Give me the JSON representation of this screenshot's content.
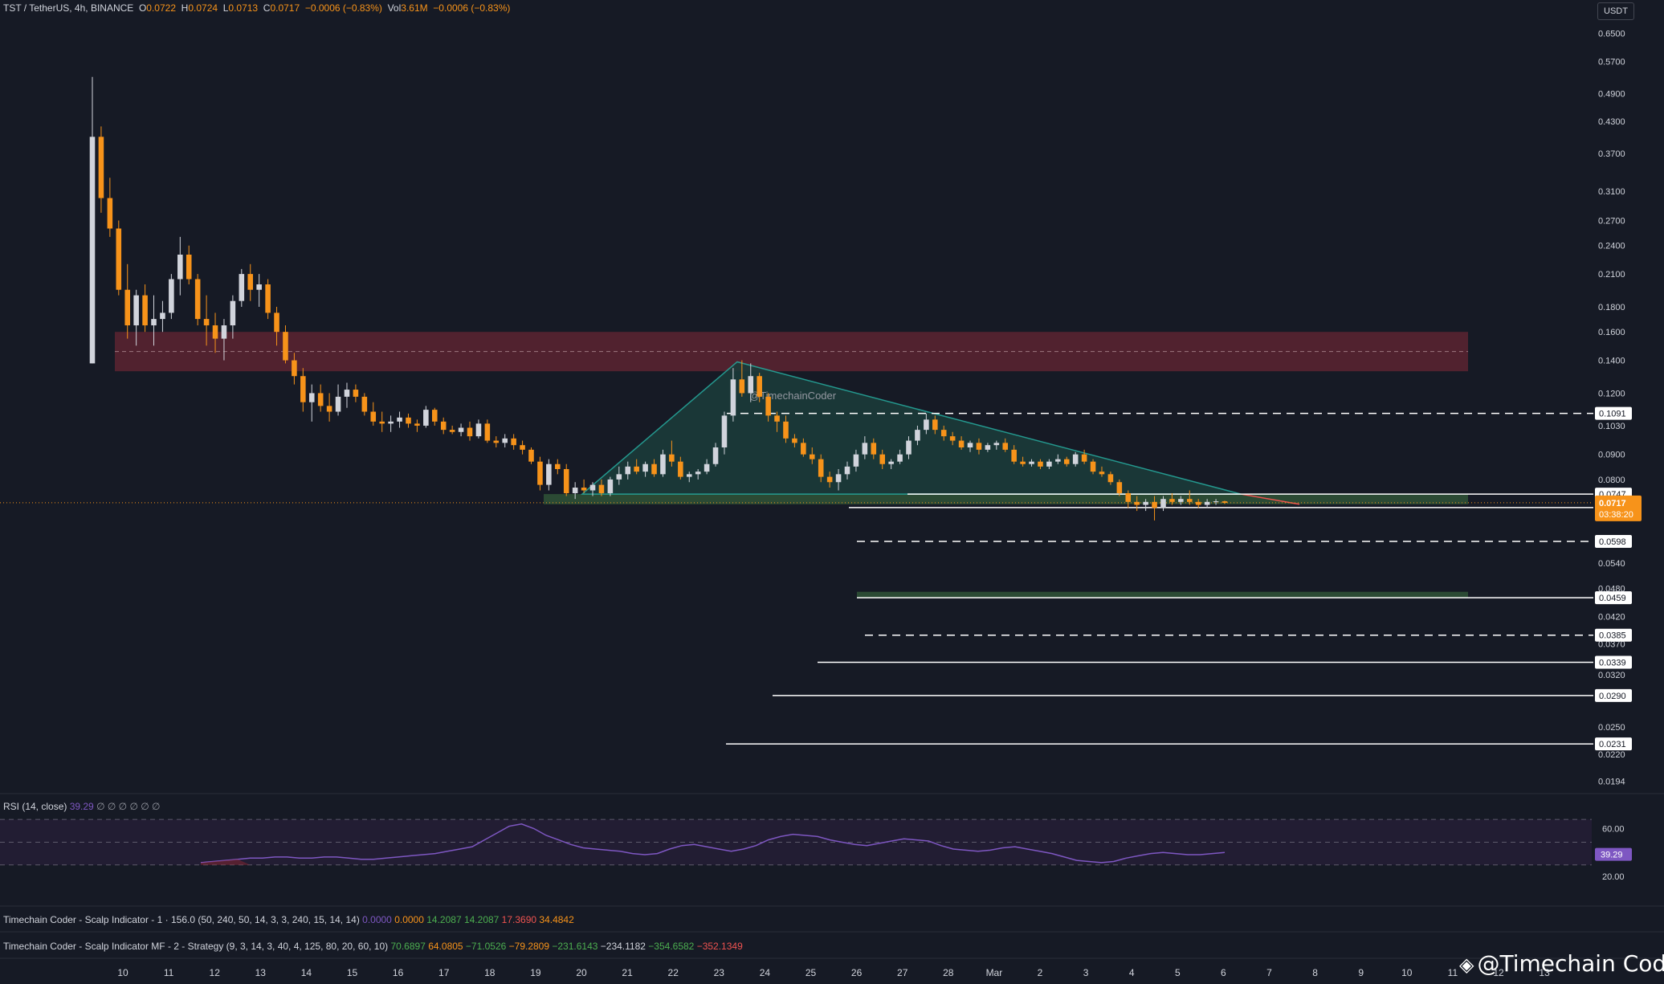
{
  "header": {
    "symbol": "TST / TetherUS, 4h, BINANCE",
    "o_label": "O",
    "o": "0.0722",
    "h_label": "H",
    "h": "0.0724",
    "l_label": "L",
    "l": "0.0713",
    "c_label": "C",
    "c": "0.0717",
    "change": "−0.0006 (−0.83%)",
    "vol_label": "Vol",
    "vol": "3.61M",
    "vol_change": "−0.0006 (−0.83%)"
  },
  "currency": "USDT",
  "watermark_chart": "@TimechainCoder",
  "watermark_corner": "@Timechain Coder",
  "rsi": {
    "title": "RSI (14, close)",
    "value": "39.29",
    "extra": "∅ ∅ ∅ ∅ ∅ ∅",
    "levels": [
      "60.00",
      "20.00"
    ],
    "badge": "39.29"
  },
  "indicator1": {
    "label": "Timechain Coder - Scalp Indicator - 1 · 156.0 (50, 240, 50, 14, 3, 3, 240, 15, 14, 14)",
    "values": [
      {
        "v": "0.0000",
        "c": "purple"
      },
      {
        "v": "0.0000",
        "c": "orange"
      },
      {
        "v": "14.2087",
        "c": "green"
      },
      {
        "v": "14.2087",
        "c": "green"
      },
      {
        "v": "17.3690",
        "c": "red"
      },
      {
        "v": "34.4842",
        "c": "orange"
      }
    ]
  },
  "indicator2": {
    "label": "Timechain Coder - Scalp Indicator MF - 2 - Strategy (9, 3, 14, 3, 40, 4, 125, 80, 20, 60, 10)",
    "values": [
      {
        "v": "70.6897",
        "c": "green"
      },
      {
        "v": "64.0805",
        "c": "orange"
      },
      {
        "v": "−71.0526",
        "c": "green"
      },
      {
        "v": "−79.2809",
        "c": "orange"
      },
      {
        "v": "−231.6143",
        "c": "green"
      },
      {
        "v": "−234.1182",
        "c": "white"
      },
      {
        "v": "−354.6582",
        "c": "green"
      },
      {
        "v": "−352.1349",
        "c": "red"
      }
    ]
  },
  "chart_data": {
    "type": "candlestick",
    "price_scale": "log",
    "y_ticks": [
      "0.6500",
      "0.5700",
      "0.4900",
      "0.4300",
      "0.3700",
      "0.3100",
      "0.2700",
      "0.2400",
      "0.2100",
      "0.1800",
      "0.1600",
      "0.1400",
      "0.1200",
      "0.1030",
      "0.0900",
      "0.0800",
      "0.0540",
      "0.0480",
      "0.0420",
      "0.0370",
      "0.0320",
      "0.0250",
      "0.0220",
      "0.0194"
    ],
    "x_ticks": [
      "10",
      "11",
      "12",
      "13",
      "14",
      "15",
      "16",
      "17",
      "18",
      "19",
      "20",
      "21",
      "22",
      "23",
      "24",
      "25",
      "26",
      "27",
      "28",
      "Mar",
      "2",
      "3",
      "4",
      "5",
      "6",
      "7",
      "8",
      "9",
      "10",
      "11",
      "12",
      "13"
    ],
    "current_price": "0.0717",
    "countdown": "03:38:20",
    "level_labels": [
      "0.1091",
      "0.0747",
      "0.0701",
      "0.0598",
      "0.0459",
      "0.0385",
      "0.0339",
      "0.0290",
      "0.0231"
    ],
    "levels": [
      {
        "price": 0.1091,
        "style": "dashed"
      },
      {
        "price": 0.0747,
        "style": "solid"
      },
      {
        "price": 0.0701,
        "style": "solid"
      },
      {
        "price": 0.0598,
        "style": "dashed"
      },
      {
        "price": 0.0459,
        "style": "solid"
      },
      {
        "price": 0.0385,
        "style": "dashed"
      },
      {
        "price": 0.0339,
        "style": "solid"
      },
      {
        "price": 0.029,
        "style": "solid"
      },
      {
        "price": 0.0231,
        "style": "solid"
      }
    ],
    "zones": [
      {
        "name": "resistance",
        "from": 0.133,
        "to": 0.16,
        "color": "#5c2431"
      },
      {
        "name": "support-top",
        "from": 0.0712,
        "to": 0.0747,
        "color": "#2f5437"
      },
      {
        "name": "support-low",
        "from": 0.0459,
        "to": 0.0472,
        "color": "#2f5437"
      }
    ],
    "triangle": {
      "apex_high": 0.139,
      "base": 0.0747,
      "apex_date": "7"
    },
    "candles": [
      [
        0.138,
        0.53,
        0.138,
        0.4
      ],
      [
        0.4,
        0.42,
        0.28,
        0.3
      ],
      [
        0.3,
        0.33,
        0.25,
        0.26
      ],
      [
        0.26,
        0.27,
        0.19,
        0.195
      ],
      [
        0.195,
        0.22,
        0.155,
        0.165
      ],
      [
        0.165,
        0.195,
        0.15,
        0.19
      ],
      [
        0.19,
        0.2,
        0.16,
        0.165
      ],
      [
        0.165,
        0.19,
        0.15,
        0.17
      ],
      [
        0.17,
        0.185,
        0.16,
        0.175
      ],
      [
        0.175,
        0.21,
        0.17,
        0.205
      ],
      [
        0.205,
        0.25,
        0.19,
        0.23
      ],
      [
        0.23,
        0.24,
        0.2,
        0.205
      ],
      [
        0.205,
        0.21,
        0.165,
        0.17
      ],
      [
        0.17,
        0.19,
        0.15,
        0.165
      ],
      [
        0.165,
        0.175,
        0.145,
        0.155
      ],
      [
        0.155,
        0.17,
        0.14,
        0.165
      ],
      [
        0.165,
        0.19,
        0.155,
        0.185
      ],
      [
        0.185,
        0.215,
        0.18,
        0.21
      ],
      [
        0.21,
        0.22,
        0.185,
        0.195
      ],
      [
        0.195,
        0.21,
        0.18,
        0.2
      ],
      [
        0.2,
        0.205,
        0.17,
        0.175
      ],
      [
        0.175,
        0.18,
        0.15,
        0.16
      ],
      [
        0.16,
        0.165,
        0.138,
        0.14
      ],
      [
        0.14,
        0.145,
        0.125,
        0.13
      ],
      [
        0.13,
        0.135,
        0.11,
        0.115
      ],
      [
        0.115,
        0.125,
        0.105,
        0.12
      ],
      [
        0.12,
        0.125,
        0.11,
        0.113
      ],
      [
        0.113,
        0.12,
        0.105,
        0.11
      ],
      [
        0.11,
        0.125,
        0.108,
        0.118
      ],
      [
        0.118,
        0.126,
        0.112,
        0.122
      ],
      [
        0.122,
        0.125,
        0.115,
        0.118
      ],
      [
        0.118,
        0.12,
        0.108,
        0.11
      ],
      [
        0.11,
        0.115,
        0.103,
        0.105
      ],
      [
        0.105,
        0.11,
        0.1,
        0.104
      ],
      [
        0.104,
        0.108,
        0.1,
        0.105
      ],
      [
        0.105,
        0.11,
        0.102,
        0.107
      ],
      [
        0.107,
        0.109,
        0.102,
        0.104
      ],
      [
        0.104,
        0.106,
        0.1,
        0.103
      ],
      [
        0.103,
        0.113,
        0.102,
        0.111
      ],
      [
        0.111,
        0.112,
        0.103,
        0.105
      ],
      [
        0.105,
        0.107,
        0.099,
        0.101
      ],
      [
        0.101,
        0.103,
        0.099,
        0.1
      ],
      [
        0.1,
        0.104,
        0.098,
        0.102
      ],
      [
        0.102,
        0.105,
        0.096,
        0.098
      ],
      [
        0.098,
        0.106,
        0.097,
        0.104
      ],
      [
        0.104,
        0.106,
        0.095,
        0.096
      ],
      [
        0.096,
        0.098,
        0.093,
        0.095
      ],
      [
        0.095,
        0.099,
        0.093,
        0.097
      ],
      [
        0.097,
        0.099,
        0.092,
        0.094
      ],
      [
        0.094,
        0.096,
        0.09,
        0.092
      ],
      [
        0.092,
        0.093,
        0.086,
        0.087
      ],
      [
        0.087,
        0.089,
        0.076,
        0.078
      ],
      [
        0.078,
        0.088,
        0.076,
        0.086
      ],
      [
        0.086,
        0.088,
        0.082,
        0.084
      ],
      [
        0.084,
        0.086,
        0.074,
        0.075
      ],
      [
        0.075,
        0.079,
        0.073,
        0.077
      ],
      [
        0.077,
        0.08,
        0.075,
        0.076
      ],
      [
        0.076,
        0.079,
        0.074,
        0.078
      ],
      [
        0.078,
        0.08,
        0.074,
        0.075
      ],
      [
        0.075,
        0.081,
        0.074,
        0.08
      ],
      [
        0.08,
        0.085,
        0.078,
        0.082
      ],
      [
        0.082,
        0.087,
        0.08,
        0.085
      ],
      [
        0.085,
        0.088,
        0.082,
        0.083
      ],
      [
        0.083,
        0.087,
        0.081,
        0.086
      ],
      [
        0.086,
        0.088,
        0.081,
        0.082
      ],
      [
        0.082,
        0.092,
        0.081,
        0.09
      ],
      [
        0.09,
        0.096,
        0.085,
        0.087
      ],
      [
        0.087,
        0.089,
        0.08,
        0.081
      ],
      [
        0.081,
        0.083,
        0.079,
        0.082
      ],
      [
        0.082,
        0.084,
        0.08,
        0.083
      ],
      [
        0.083,
        0.088,
        0.082,
        0.086
      ],
      [
        0.086,
        0.095,
        0.085,
        0.093
      ],
      [
        0.093,
        0.11,
        0.09,
        0.108
      ],
      [
        0.108,
        0.135,
        0.105,
        0.128
      ],
      [
        0.128,
        0.14,
        0.118,
        0.12
      ],
      [
        0.12,
        0.138,
        0.115,
        0.13
      ],
      [
        0.13,
        0.132,
        0.115,
        0.118
      ],
      [
        0.118,
        0.12,
        0.105,
        0.108
      ],
      [
        0.108,
        0.11,
        0.1,
        0.105
      ],
      [
        0.105,
        0.108,
        0.095,
        0.097
      ],
      [
        0.097,
        0.099,
        0.093,
        0.095
      ],
      [
        0.095,
        0.097,
        0.089,
        0.09
      ],
      [
        0.09,
        0.093,
        0.086,
        0.088
      ],
      [
        0.088,
        0.09,
        0.079,
        0.081
      ],
      [
        0.081,
        0.083,
        0.077,
        0.079
      ],
      [
        0.079,
        0.084,
        0.076,
        0.082
      ],
      [
        0.082,
        0.087,
        0.08,
        0.085
      ],
      [
        0.085,
        0.092,
        0.083,
        0.09
      ],
      [
        0.09,
        0.098,
        0.088,
        0.095
      ],
      [
        0.095,
        0.097,
        0.088,
        0.09
      ],
      [
        0.09,
        0.092,
        0.084,
        0.086
      ],
      [
        0.086,
        0.088,
        0.084,
        0.087
      ],
      [
        0.087,
        0.092,
        0.086,
        0.09
      ],
      [
        0.09,
        0.098,
        0.088,
        0.096
      ],
      [
        0.096,
        0.103,
        0.094,
        0.101
      ],
      [
        0.101,
        0.109,
        0.099,
        0.106
      ],
      [
        0.106,
        0.108,
        0.099,
        0.101
      ],
      [
        0.101,
        0.103,
        0.096,
        0.098
      ],
      [
        0.098,
        0.1,
        0.094,
        0.096
      ],
      [
        0.096,
        0.098,
        0.092,
        0.093
      ],
      [
        0.093,
        0.096,
        0.091,
        0.095
      ],
      [
        0.095,
        0.097,
        0.09,
        0.092
      ],
      [
        0.092,
        0.095,
        0.091,
        0.094
      ],
      [
        0.094,
        0.096,
        0.092,
        0.095
      ],
      [
        0.095,
        0.097,
        0.091,
        0.092
      ],
      [
        0.092,
        0.094,
        0.086,
        0.087
      ],
      [
        0.087,
        0.089,
        0.085,
        0.086
      ],
      [
        0.086,
        0.088,
        0.085,
        0.087
      ],
      [
        0.087,
        0.088,
        0.084,
        0.085
      ],
      [
        0.085,
        0.088,
        0.084,
        0.087
      ],
      [
        0.087,
        0.09,
        0.086,
        0.088
      ],
      [
        0.088,
        0.089,
        0.085,
        0.086
      ],
      [
        0.086,
        0.091,
        0.085,
        0.09
      ],
      [
        0.09,
        0.092,
        0.086,
        0.087
      ],
      [
        0.087,
        0.088,
        0.082,
        0.083
      ],
      [
        0.083,
        0.085,
        0.081,
        0.082
      ],
      [
        0.082,
        0.083,
        0.078,
        0.079
      ],
      [
        0.079,
        0.08,
        0.074,
        0.075
      ],
      [
        0.075,
        0.076,
        0.07,
        0.072
      ],
      [
        0.072,
        0.074,
        0.069,
        0.071
      ],
      [
        0.071,
        0.073,
        0.069,
        0.072
      ],
      [
        0.072,
        0.074,
        0.066,
        0.07
      ],
      [
        0.07,
        0.074,
        0.069,
        0.073
      ],
      [
        0.073,
        0.075,
        0.071,
        0.072
      ],
      [
        0.072,
        0.074,
        0.071,
        0.073
      ],
      [
        0.073,
        0.076,
        0.071,
        0.072
      ],
      [
        0.072,
        0.073,
        0.07,
        0.071
      ],
      [
        0.071,
        0.073,
        0.07,
        0.072
      ],
      [
        0.072,
        0.073,
        0.071,
        0.0722
      ],
      [
        0.0722,
        0.0724,
        0.0713,
        0.0717
      ]
    ],
    "rsi_series": [
      32,
      33,
      34,
      35,
      36,
      36,
      37,
      37,
      36,
      36,
      37,
      37,
      36,
      35,
      35,
      36,
      37,
      38,
      39,
      40,
      42,
      44,
      46,
      52,
      58,
      64,
      66,
      62,
      56,
      52,
      48,
      45,
      44,
      43,
      42,
      40,
      39,
      40,
      44,
      47,
      48,
      46,
      44,
      42,
      44,
      47,
      52,
      55,
      57,
      56,
      55,
      52,
      50,
      48,
      47,
      49,
      51,
      53,
      52,
      51,
      47,
      44,
      43,
      42,
      43,
      45,
      46,
      44,
      42,
      40,
      37,
      34,
      33,
      32,
      33,
      36,
      38,
      40,
      41,
      40,
      39,
      39,
      40,
      41
    ],
    "rsi_range": [
      0,
      100
    ]
  }
}
